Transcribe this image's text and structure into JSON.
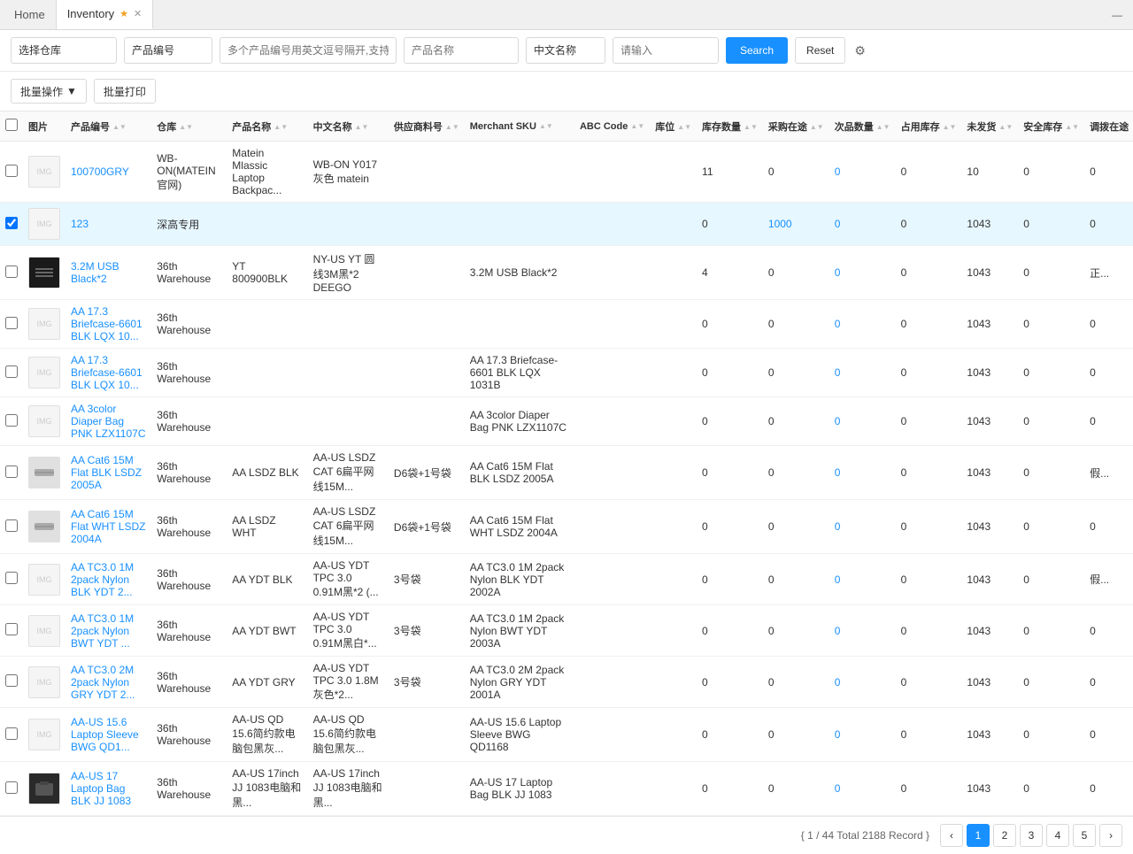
{
  "tabs": [
    {
      "id": "home",
      "label": "Home",
      "active": false
    },
    {
      "id": "inventory",
      "label": "Inventory",
      "active": true,
      "starred": true
    }
  ],
  "toolbar": {
    "warehouse_placeholder": "选择仓库",
    "product_code_option": "产品编号",
    "product_code_placeholder": "多个产品编号用英文逗号隔开,支持直接复制Excel数据",
    "product_name_placeholder": "产品名称",
    "cn_name_option": "中文名称",
    "cn_name_placeholder": "请输入",
    "search_label": "Search",
    "reset_label": "Reset"
  },
  "actions": {
    "batch_label": "批量操作",
    "print_label": "批量打印"
  },
  "table": {
    "columns": [
      "图片",
      "产品编号",
      "仓库",
      "产品名称",
      "中文名称",
      "供应商料号",
      "Merchant SKU",
      "ABC Code",
      "库位",
      "库存数量",
      "采购在途",
      "次品数量",
      "占用库存",
      "未发货",
      "安全库存",
      "调拨在途"
    ],
    "rows": [
      {
        "id": 1,
        "img_type": "empty",
        "product_code": "100700GRY",
        "warehouse": "WB-ON(MATEIN官网)",
        "product_name": "Matein Mlassic Laptop Backpac...",
        "cn_name": "WB-ON Y017灰色 matein",
        "supplier_code": "",
        "merchant_sku": "",
        "abc_code": "",
        "location": "",
        "stock": "11",
        "purchase_transit": "0",
        "defective": "0",
        "occupied": "0",
        "unshipped": "10",
        "safety": "0",
        "transfer": ""
      },
      {
        "id": 2,
        "img_type": "empty",
        "product_code": "123",
        "warehouse": "深高专用",
        "product_name": "",
        "cn_name": "",
        "supplier_code": "",
        "merchant_sku": "",
        "abc_code": "",
        "location": "",
        "stock": "0",
        "purchase_transit": "1000",
        "defective": "0",
        "occupied": "0",
        "unshipped": "1043",
        "safety": "0",
        "transfer": ""
      },
      {
        "id": 3,
        "img_type": "cables",
        "product_code": "3.2M USB Black*2",
        "warehouse": "36th Warehouse",
        "product_name": "YT 800900BLK",
        "cn_name": "NY-US YT 圆线3M黑*2 DEEGO",
        "supplier_code": "",
        "merchant_sku": "3.2M USB Black*2",
        "abc_code": "",
        "location": "",
        "stock": "4",
        "purchase_transit": "0",
        "defective": "0",
        "occupied": "0",
        "unshipped": "1043",
        "safety": "0",
        "transfer": "正..."
      },
      {
        "id": 4,
        "img_type": "empty",
        "product_code": "AA 17.3 Briefcase-6601 BLK LQX 10...",
        "warehouse": "36th Warehouse",
        "product_name": "",
        "cn_name": "",
        "supplier_code": "",
        "merchant_sku": "",
        "abc_code": "",
        "location": "",
        "stock": "0",
        "purchase_transit": "0",
        "defective": "0",
        "occupied": "0",
        "unshipped": "1043",
        "safety": "0",
        "transfer": ""
      },
      {
        "id": 5,
        "img_type": "empty",
        "product_code": "AA 17.3 Briefcase-6601 BLK LQX 10...",
        "warehouse": "36th Warehouse",
        "product_name": "",
        "cn_name": "",
        "supplier_code": "",
        "merchant_sku": "AA 17.3 Briefcase-6601 BLK LQX 1031B",
        "abc_code": "",
        "location": "",
        "stock": "0",
        "purchase_transit": "0",
        "defective": "0",
        "occupied": "0",
        "unshipped": "1043",
        "safety": "0",
        "transfer": ""
      },
      {
        "id": 6,
        "img_type": "empty",
        "product_code": "AA 3color Diaper Bag PNK LZX1107C",
        "warehouse": "36th Warehouse",
        "product_name": "",
        "cn_name": "",
        "supplier_code": "",
        "merchant_sku": "AA 3color Diaper Bag PNK LZX1107C",
        "abc_code": "",
        "location": "",
        "stock": "0",
        "purchase_transit": "0",
        "defective": "0",
        "occupied": "0",
        "unshipped": "1043",
        "safety": "0",
        "transfer": ""
      },
      {
        "id": 7,
        "img_type": "cable_cat",
        "product_code": "AA Cat6 15M Flat BLK LSDZ 2005A",
        "warehouse": "36th Warehouse",
        "product_name": "AA LSDZ BLK",
        "cn_name": "AA-US LSDZ CAT 6扁平网线15M...",
        "supplier_code": "D6袋+1号袋",
        "merchant_sku": "AA Cat6 15M Flat BLK LSDZ 2005A",
        "abc_code": "",
        "location": "",
        "stock": "0",
        "purchase_transit": "0",
        "defective": "0",
        "occupied": "0",
        "unshipped": "1043",
        "safety": "0",
        "transfer": "假..."
      },
      {
        "id": 8,
        "img_type": "cable_cat",
        "product_code": "AA Cat6 15M Flat WHT LSDZ 2004A",
        "warehouse": "36th Warehouse",
        "product_name": "AA LSDZ WHT",
        "cn_name": "AA-US LSDZ CAT 6扁平网线15M...",
        "supplier_code": "D6袋+1号袋",
        "merchant_sku": "AA Cat6 15M Flat WHT LSDZ 2004A",
        "abc_code": "",
        "location": "",
        "stock": "0",
        "purchase_transit": "0",
        "defective": "0",
        "occupied": "0",
        "unshipped": "1043",
        "safety": "0",
        "transfer": ""
      },
      {
        "id": 9,
        "img_type": "empty",
        "product_code": "AA TC3.0 1M 2pack Nylon BLK YDT 2...",
        "warehouse": "36th Warehouse",
        "product_name": "AA YDT BLK",
        "cn_name": "AA-US YDT TPC 3.0 0.91M黑*2 (...",
        "supplier_code": "3号袋",
        "merchant_sku": "AA TC3.0 1M 2pack Nylon BLK YDT 2002A",
        "abc_code": "",
        "location": "",
        "stock": "0",
        "purchase_transit": "0",
        "defective": "0",
        "occupied": "0",
        "unshipped": "1043",
        "safety": "0",
        "transfer": "假..."
      },
      {
        "id": 10,
        "img_type": "empty",
        "product_code": "AA TC3.0 1M 2pack Nylon BWT YDT ...",
        "warehouse": "36th Warehouse",
        "product_name": "AA YDT BWT",
        "cn_name": "AA-US YDT TPC 3.0 0.91M黑白*...",
        "supplier_code": "3号袋",
        "merchant_sku": "AA TC3.0 1M 2pack Nylon BWT YDT 2003A",
        "abc_code": "",
        "location": "",
        "stock": "0",
        "purchase_transit": "0",
        "defective": "0",
        "occupied": "0",
        "unshipped": "1043",
        "safety": "0",
        "transfer": ""
      },
      {
        "id": 11,
        "img_type": "empty",
        "product_code": "AA TC3.0 2M 2pack Nylon GRY YDT 2...",
        "warehouse": "36th Warehouse",
        "product_name": "AA YDT GRY",
        "cn_name": "AA-US YDT TPC 3.0 1.8M灰色*2...",
        "supplier_code": "3号袋",
        "merchant_sku": "AA TC3.0 2M 2pack Nylon GRY YDT 2001A",
        "abc_code": "",
        "location": "",
        "stock": "0",
        "purchase_transit": "0",
        "defective": "0",
        "occupied": "0",
        "unshipped": "1043",
        "safety": "0",
        "transfer": ""
      },
      {
        "id": 12,
        "img_type": "empty",
        "product_code": "AA-US 15.6 Laptop Sleeve BWG QD1...",
        "warehouse": "36th Warehouse",
        "product_name": "AA-US QD 15.6简约款电脑包黑灰...",
        "cn_name": "AA-US QD 15.6简约款电脑包黑灰...",
        "supplier_code": "",
        "merchant_sku": "AA-US 15.6 Laptop Sleeve BWG QD1168",
        "abc_code": "",
        "location": "",
        "stock": "0",
        "purchase_transit": "0",
        "defective": "0",
        "occupied": "0",
        "unshipped": "1043",
        "safety": "0",
        "transfer": ""
      },
      {
        "id": 13,
        "img_type": "laptop_bag",
        "product_code": "AA-US 17 Laptop Bag BLK JJ 1083",
        "warehouse": "36th Warehouse",
        "product_name": "AA-US 17inch JJ 1083电脑和黑...",
        "cn_name": "AA-US 17inch JJ 1083电脑和黑...",
        "supplier_code": "",
        "merchant_sku": "AA-US 17 Laptop Bag BLK JJ 1083",
        "abc_code": "",
        "location": "",
        "stock": "0",
        "purchase_transit": "0",
        "defective": "0",
        "occupied": "0",
        "unshipped": "1043",
        "safety": "0",
        "transfer": ""
      }
    ]
  },
  "pagination": {
    "info": "{ 1 / 44 Total 2188 Record }",
    "pages": [
      "1",
      "2",
      "3",
      "4",
      "5"
    ],
    "current": "1"
  },
  "colors": {
    "blue": "#1890ff",
    "header_bg": "#fafafa",
    "border": "#e8e8e8"
  }
}
